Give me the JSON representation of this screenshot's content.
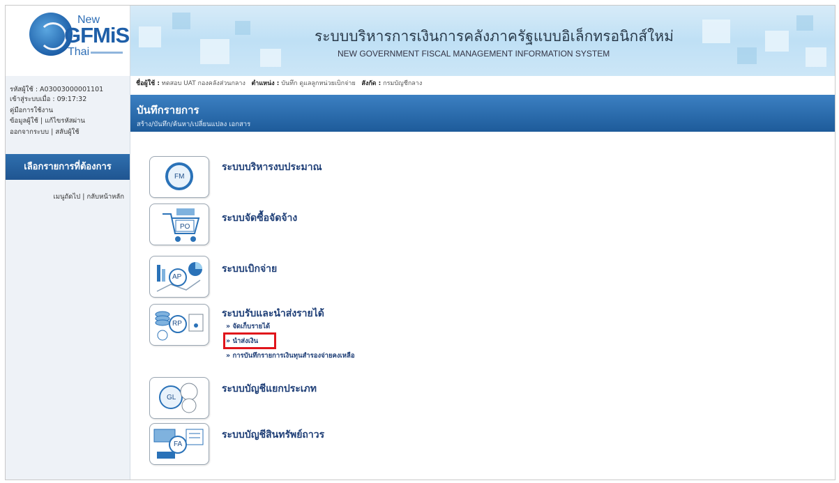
{
  "header": {
    "logo": {
      "new": "New",
      "gfmis": "GFMiS",
      "thai": "Thai"
    },
    "title_th": "ระบบบริหารการเงินการคลังภาครัฐแบบอิเล็กทรอนิกส์ใหม่",
    "title_en": "NEW GOVERNMENT FISCAL MANAGEMENT INFORMATION SYSTEM"
  },
  "user_panel": {
    "user_code": "รหัสผู้ใช้ : A03003000001101",
    "login_time": "เข้าสู่ระบบเมื่อ : 09:17:32",
    "manual": "คู่มือการใช้งาน",
    "user_info": "ข้อมูลผู้ใช้",
    "edit_password": "แก้ไขรหัสผ่าน",
    "logout": "ออกจากระบบ",
    "switch_user": "สลับผู้ใช้",
    "separator": "|"
  },
  "menu": {
    "heading": "เลือกรายการที่ต้องการ",
    "prev_menu": "เมนูถัดไป",
    "home": "กลับหน้าหลัก",
    "separator": "|"
  },
  "info_bar": {
    "name_label": "ชื่อผู้ใช้ :",
    "name_value": "ทดสอบ UAT กองคลังส่วนกลาง",
    "position_label": "ตำแหน่ง :",
    "position_value": "บันทึก ดูแลลูกหน่วยเบิกจ่าย",
    "org_label": "สังกัด :",
    "org_value": "กรมบัญชีกลาง"
  },
  "page": {
    "title": "บันทึกรายการ",
    "subtitle": "สร้าง/บันทึก/ค้นหา/เปลี่ยนแปลง เอกสาร"
  },
  "modules": [
    {
      "code": "FM",
      "title": "ระบบบริหารงบประมาณ"
    },
    {
      "code": "PO",
      "title": "ระบบจัดซื้อจัดจ้าง"
    },
    {
      "code": "AP",
      "title": "ระบบเบิกจ่าย"
    },
    {
      "code": "RP",
      "title": "ระบบรับและนำส่งรายได้",
      "links": [
        "» จัดเก็บรายได้",
        "» นำส่งเงิน",
        "» การบันทึกรายการเงินทุนสำรองจ่ายคงเหลือ"
      ]
    },
    {
      "code": "GL",
      "title": "ระบบบัญชีแยกประเภท"
    },
    {
      "code": "FA",
      "title": "ระบบบัญชีสินทรัพย์ถาวร"
    }
  ],
  "colors": {
    "highlight": "#e0141b",
    "title_bar": "#1d5b9a",
    "module_text": "#1f3f77"
  }
}
